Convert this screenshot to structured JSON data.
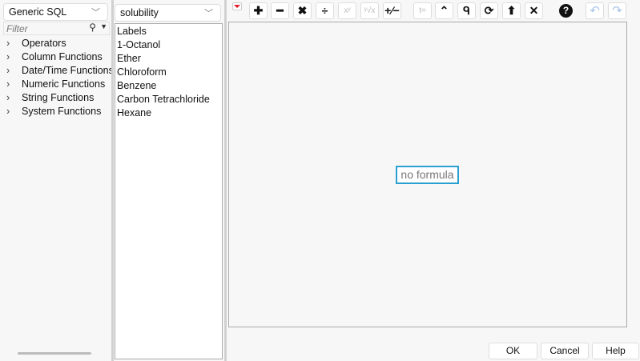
{
  "function_panel": {
    "category_select": "Generic SQL",
    "filter_placeholder": "Filter",
    "groups": [
      "Operators",
      "Column Functions",
      "Date/Time Functions",
      "Numeric Functions",
      "String Functions",
      "System Functions"
    ]
  },
  "column_panel": {
    "table_select": "solubility",
    "columns": [
      "Labels",
      "1-Octanol",
      "Ether",
      "Chloroform",
      "Benzene",
      "Carbon Tetrachloride",
      "Hexane"
    ]
  },
  "toolbar": {
    "buttons": [
      {
        "icon": "plus-icon",
        "glyph": "✚"
      },
      {
        "icon": "minus-icon",
        "glyph": "━"
      },
      {
        "icon": "multiply-icon",
        "glyph": "✖"
      },
      {
        "icon": "divide-icon",
        "glyph": "÷"
      },
      {
        "icon": "power-icon",
        "glyph": "xʸ",
        "disabled": true
      },
      {
        "icon": "root-icon",
        "glyph": "ʸ√x",
        "disabled": true
      },
      {
        "icon": "negate-icon",
        "glyph": "+⁄−"
      },
      {
        "icon": "local-variable-icon",
        "glyph": "t=",
        "disabled": true
      },
      {
        "icon": "peel-icon",
        "glyph": "⌃"
      },
      {
        "icon": "unary-icon",
        "glyph": "ᑫ"
      },
      {
        "icon": "swap-icon",
        "glyph": "⟳"
      },
      {
        "icon": "expand-icon",
        "glyph": "⬆"
      },
      {
        "icon": "delete-icon",
        "glyph": "✕"
      },
      {
        "icon": "help-icon",
        "glyph": "?"
      },
      {
        "icon": "undo-icon",
        "glyph": "↶",
        "disabled": true
      },
      {
        "icon": "redo-icon",
        "glyph": "↷",
        "disabled": true
      }
    ]
  },
  "formula": {
    "placeholder_text": "no formula"
  },
  "dialog": {
    "ok": "OK",
    "cancel": "Cancel",
    "help": "Help"
  },
  "colors": {
    "accent": "#2a9fd0",
    "menu_triangle": "#e0202a"
  }
}
